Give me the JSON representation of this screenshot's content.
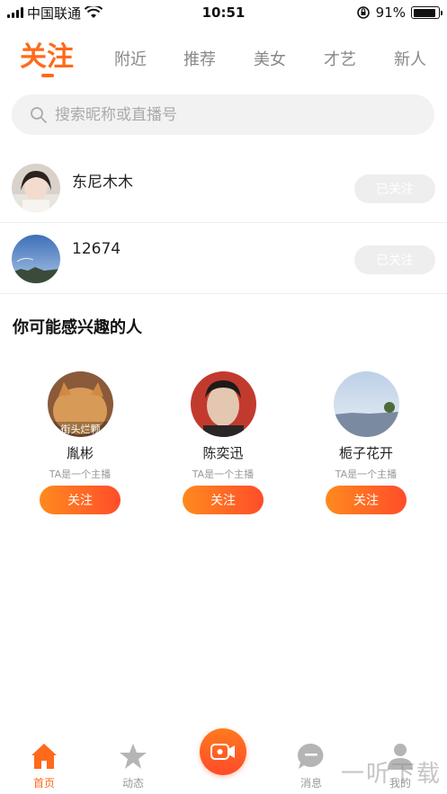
{
  "status_bar": {
    "carrier": "中国联通",
    "time": "10:51",
    "battery": "91%",
    "battery_level": 0.91
  },
  "tabs": [
    {
      "label": "关注",
      "active": true
    },
    {
      "label": "附近"
    },
    {
      "label": "推荐"
    },
    {
      "label": "美女"
    },
    {
      "label": "才艺"
    },
    {
      "label": "新人"
    }
  ],
  "search": {
    "placeholder": "搜索昵称或直播号"
  },
  "following": [
    {
      "name": "东尼木木",
      "button": "已关注"
    },
    {
      "name": "12674",
      "button": "已关注"
    }
  ],
  "suggest": {
    "title": "你可能感兴趣的人",
    "people": [
      {
        "name": "胤彬",
        "subtitle": "TA是一个主播",
        "button": "关注",
        "avatar_caption": "街头烂颗"
      },
      {
        "name": "陈奕迅",
        "subtitle": "TA是一个主播",
        "button": "关注"
      },
      {
        "name": "栀子花开",
        "subtitle": "TA是一个主播",
        "button": "关注"
      }
    ]
  },
  "bottom_nav": [
    {
      "label": "首页",
      "icon": "home-icon",
      "active": true
    },
    {
      "label": "动态",
      "icon": "star-icon"
    },
    {
      "label": "",
      "icon": "live-camera-icon"
    },
    {
      "label": "消息",
      "icon": "message-icon"
    },
    {
      "label": "我的",
      "icon": "user-icon"
    }
  ],
  "watermark": "一听下载",
  "colors": {
    "accent": "#ff6a1a",
    "accent_end": "#ff4d2a",
    "muted": "#999999"
  }
}
